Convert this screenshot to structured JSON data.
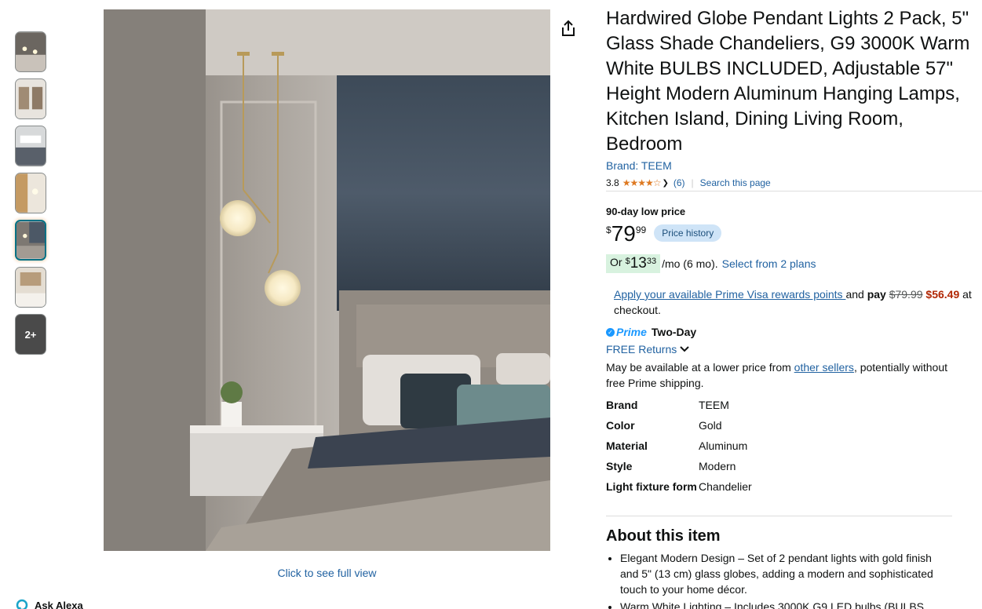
{
  "thumbnails": {
    "more_label": "2+"
  },
  "main_image": {
    "full_view_label": "Click to see full view"
  },
  "ask_alexa": "Ask Alexa",
  "product": {
    "title": "Hardwired Globe Pendant Lights 2 Pack, 5\" Glass Shade Chandeliers, G9 3000K Warm White BULBS INCLUDED, Adjustable 57\" Height Modern Aluminum Hanging Lamps, Kitchen Island, Dining Living Room, Bedroom",
    "brand_link": "Brand: TEEM",
    "rating_value": "3.8",
    "rating_stars": "★★★★☆",
    "rating_count": "(6)",
    "search_page": "Search this page"
  },
  "pricing": {
    "low_price_label": "90-day low price",
    "currency": "$",
    "whole": "79",
    "fraction": "99",
    "price_history": "Price history",
    "plan_prefix": "Or",
    "plan_currency": "$",
    "plan_whole": "13",
    "plan_fraction": "33",
    "plan_suffix": "/mo (6 mo).",
    "plan_link": "Select from 2 plans"
  },
  "visa": {
    "link": "Apply your available Prime Visa rewards points ",
    "and": "and ",
    "pay": "pay",
    "old_price": "$79.99",
    "new_price": "$56.49",
    "tail": " at checkout."
  },
  "delivery": {
    "prime": "Prime",
    "two_day": "Two-Day",
    "free_returns": "FREE Returns",
    "lower_price_pre": "May be available at a lower price from ",
    "other_sellers": "other sellers",
    "lower_price_post": ", potentially without free Prime shipping."
  },
  "specs": [
    {
      "key": "Brand",
      "value": "TEEM"
    },
    {
      "key": "Color",
      "value": "Gold"
    },
    {
      "key": "Material",
      "value": "Aluminum"
    },
    {
      "key": "Style",
      "value": "Modern"
    },
    {
      "key": "Light fixture form",
      "value": "Chandelier"
    }
  ],
  "about": {
    "heading": "About this item",
    "bullets": [
      "Elegant Modern Design – Set of 2 pendant lights with gold finish and 5\" (13 cm) glass globes, adding a modern and sophisticated touch to your home décor.",
      "Warm White Lighting – Includes 3000K G9 LED bulbs (BULBS"
    ]
  },
  "colors": {
    "link": "#2162a1",
    "star": "#de7921",
    "deal": "#b12704",
    "prime": "#1a98ff"
  }
}
